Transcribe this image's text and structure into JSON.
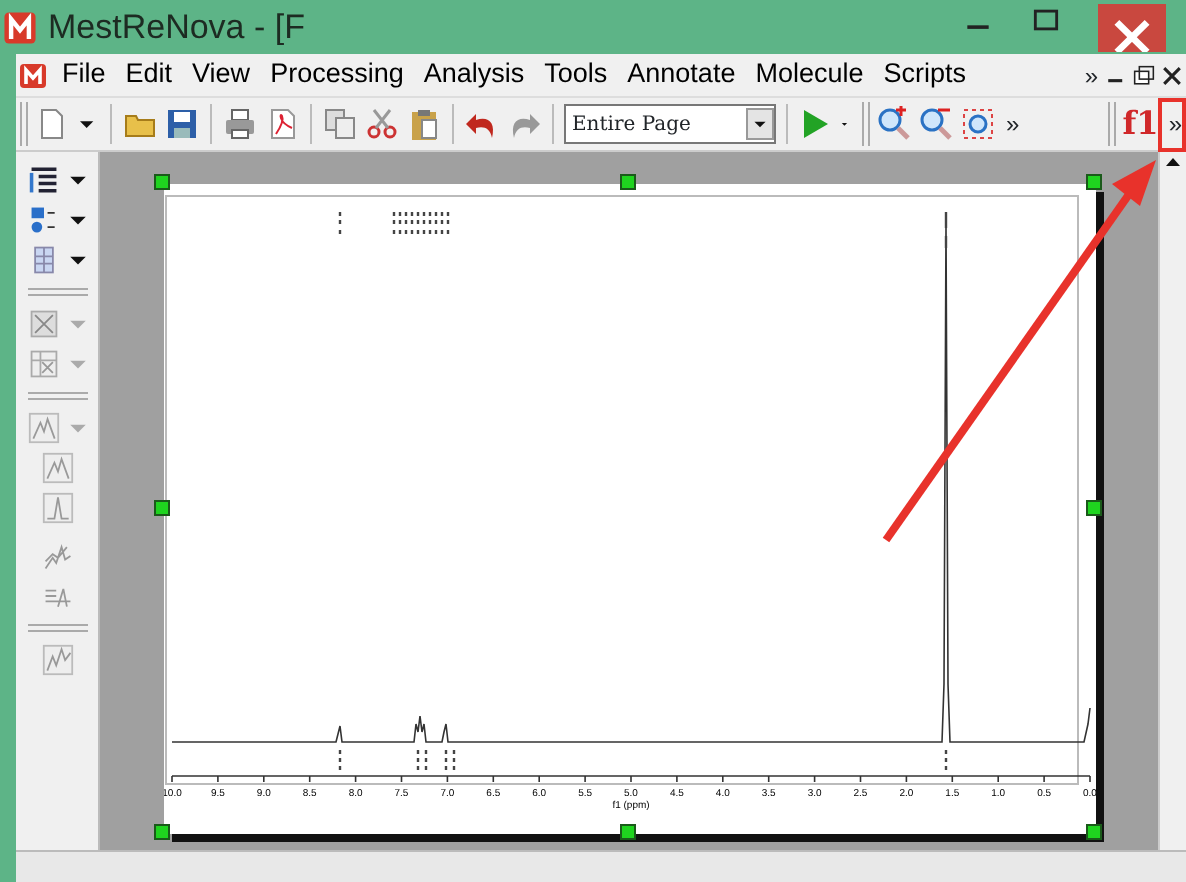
{
  "window": {
    "title": "MestReNova - [F"
  },
  "menu": {
    "items": [
      "File",
      "Edit",
      "View",
      "Processing",
      "Analysis",
      "Tools",
      "Annotate",
      "Molecule",
      "Scripts"
    ],
    "overflow": "»"
  },
  "toolbar": {
    "zoom_mode": "Entire Page",
    "overflow": [
      "»",
      "»"
    ],
    "formula_label": "f1"
  },
  "page": {
    "selected": true,
    "spectrum": {
      "xticks": [
        "10.0",
        "9.5",
        "9.0",
        "8.5",
        "8.0",
        "7.5",
        "7.0",
        "6.5",
        "6.0",
        "5.5",
        "5.0",
        "4.5",
        "4.0",
        "3.5",
        "3.0",
        "2.5",
        "2.0",
        "1.5",
        "1.0",
        "0.5",
        "0.0"
      ],
      "xlabel": "f1 (ppm)"
    }
  },
  "annotation": {
    "kind": "arrow",
    "color": "#e8322b"
  }
}
